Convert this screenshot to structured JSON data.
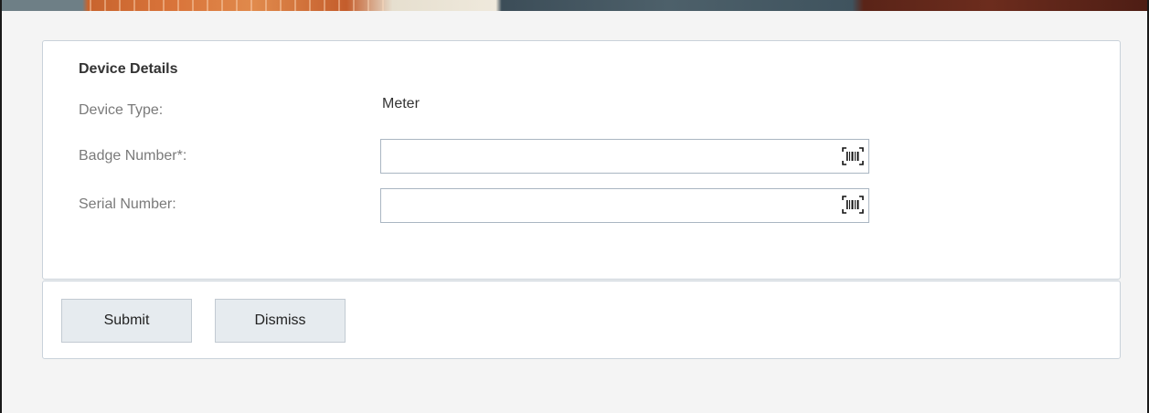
{
  "device_details": {
    "title": "Device Details",
    "device_type": {
      "label": "Device Type:",
      "value": "Meter"
    },
    "badge_number": {
      "label": "Badge Number*:",
      "value": "",
      "icon": "barcode-scan-icon"
    },
    "serial_number": {
      "label": "Serial Number:",
      "value": "",
      "icon": "barcode-scan-icon"
    }
  },
  "actions": {
    "submit_label": "Submit",
    "dismiss_label": "Dismiss"
  },
  "colors": {
    "card_border": "#c9d2da",
    "button_bg": "#e6ebef",
    "label_text": "#7a7a7a",
    "page_bg": "#f4f4f4"
  }
}
